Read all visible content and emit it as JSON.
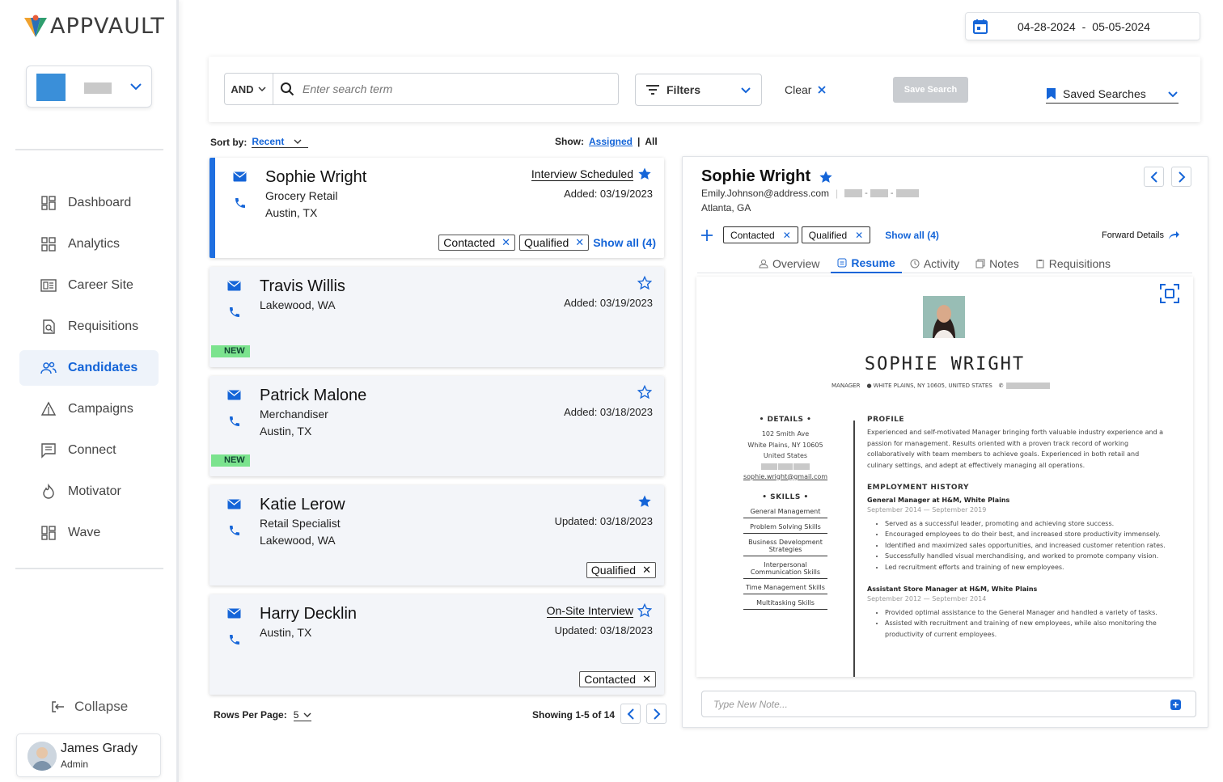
{
  "app": {
    "brand": "APPVAULT",
    "accent": "#1565d8"
  },
  "sidebar": {
    "items": [
      {
        "label": "Dashboard",
        "icon": "dashboard-icon"
      },
      {
        "label": "Analytics",
        "icon": "analytics-icon"
      },
      {
        "label": "Career Site",
        "icon": "career-site-icon"
      },
      {
        "label": "Requisitions",
        "icon": "requisitions-icon"
      },
      {
        "label": "Candidates",
        "icon": "candidates-icon",
        "active": true
      },
      {
        "label": "Campaigns",
        "icon": "campaigns-icon"
      },
      {
        "label": "Connect",
        "icon": "connect-icon"
      },
      {
        "label": "Motivator",
        "icon": "motivator-icon"
      },
      {
        "label": "Wave",
        "icon": "wave-icon"
      }
    ],
    "collapse_label": "Collapse",
    "user": {
      "name": "James Grady",
      "role": "Admin"
    }
  },
  "date_range": {
    "start": "04-28-2024",
    "separator": "-",
    "end": "05-05-2024"
  },
  "search": {
    "operator": "AND",
    "placeholder": "Enter search term",
    "filters_label": "Filters",
    "clear_label": "Clear",
    "save_label": "Save Search",
    "saved_searches_label": "Saved Searches"
  },
  "list_controls": {
    "sort_label": "Sort by:",
    "sort_value": "Recent",
    "show_label": "Show:",
    "show_assigned": "Assigned",
    "show_sep": "|",
    "show_all": "All"
  },
  "candidates": [
    {
      "name": "Sophie Wright",
      "line1": "Grocery Retail",
      "line2": "Austin, TX",
      "status": "Interview Scheduled",
      "starred": true,
      "date": "Added: 03/19/2023",
      "tags": [
        "Contacted",
        "Qualified"
      ],
      "show_all": "Show all (4)"
    },
    {
      "name": "Travis Willis",
      "line1": "Lakewood, WA",
      "line2": "",
      "status": "",
      "starred": false,
      "date": "Added: 03/19/2023",
      "badge": "NEW"
    },
    {
      "name": "Patrick Malone",
      "line1": "Merchandiser",
      "line2": "Austin, TX",
      "status": "",
      "starred": false,
      "date": "Added: 03/18/2023",
      "badge": "NEW"
    },
    {
      "name": "Katie Lerow",
      "line1": "Retail Specialist",
      "line2": "Lakewood, WA",
      "status": "",
      "starred": true,
      "date": "Updated: 03/18/2023",
      "tags": [
        "Qualified"
      ]
    },
    {
      "name": "Harry Decklin",
      "line1": "Austin, TX",
      "line2": "",
      "status": "On-Site Interview",
      "starred": false,
      "date": "Updated: 03/18/2023",
      "tags": [
        "Contacted"
      ]
    }
  ],
  "pager": {
    "rows_label": "Rows Per Page:",
    "rows_value": "5",
    "showing": "Showing 1-5 of 14"
  },
  "detail": {
    "name": "Sophie Wright",
    "email": "Emily.Johnson@address.com",
    "location": "Atlanta, GA",
    "tags": [
      "Contacted",
      "Qualified"
    ],
    "show_all": "Show all (4)",
    "forward": "Forward Details",
    "tabs": [
      "Overview",
      "Resume",
      "Activity",
      "Notes",
      "Requisitions"
    ],
    "active_tab": "Resume",
    "note_placeholder": "Type New Note..."
  },
  "resume": {
    "name": "SOPHIE WRIGHT",
    "title": "MANAGER",
    "address_line": "WHITE PLAINS, NY 10605, UNITED STATES",
    "details_h": "DETAILS",
    "details": [
      "102 Smith Ave",
      "White Plains, NY 10605",
      "United States"
    ],
    "email": "sophie.wright@gmail.com",
    "skills_h": "SKILLS",
    "skills": [
      "General Management",
      "Problem Solving Skills",
      "Business Development Strategies",
      "Interpersonal Communication Skills",
      "Time Management Skills",
      "Multitasking Skills"
    ],
    "profile_h": "PROFILE",
    "profile": "Experienced and self-motivated Manager bringing forth valuable industry experience and a passion for management. Results oriented with a proven track record of working collaboratively with team members to achieve goals. Experienced in both retail and culinary settings, and adept at effectively managing all operations.",
    "employment_h": "EMPLOYMENT HISTORY",
    "job1_title": "General Manager at H&M, White Plains",
    "job1_dates": "September 2014 — September 2019",
    "job1_bullets": [
      "Served as a successful leader, promoting and achieving store success.",
      "Encouraged employees to do their best, and increased store productivity immensely.",
      "Identified and maximized sales opportunities, and increased customer retention rates.",
      "Successfully handled visual merchandising, and worked to promote company vision.",
      "Led recruitment efforts and training of new employees."
    ],
    "job2_title": "Assistant Store Manager at H&M, White Plains",
    "job2_dates": "September 2012 — September 2014",
    "job2_bullets": [
      "Provided optimal assistance to the General Manager and handled a variety of tasks.",
      "Assisted with recruitment and training of new employees, while also monitoring the productivity of current employees."
    ]
  }
}
